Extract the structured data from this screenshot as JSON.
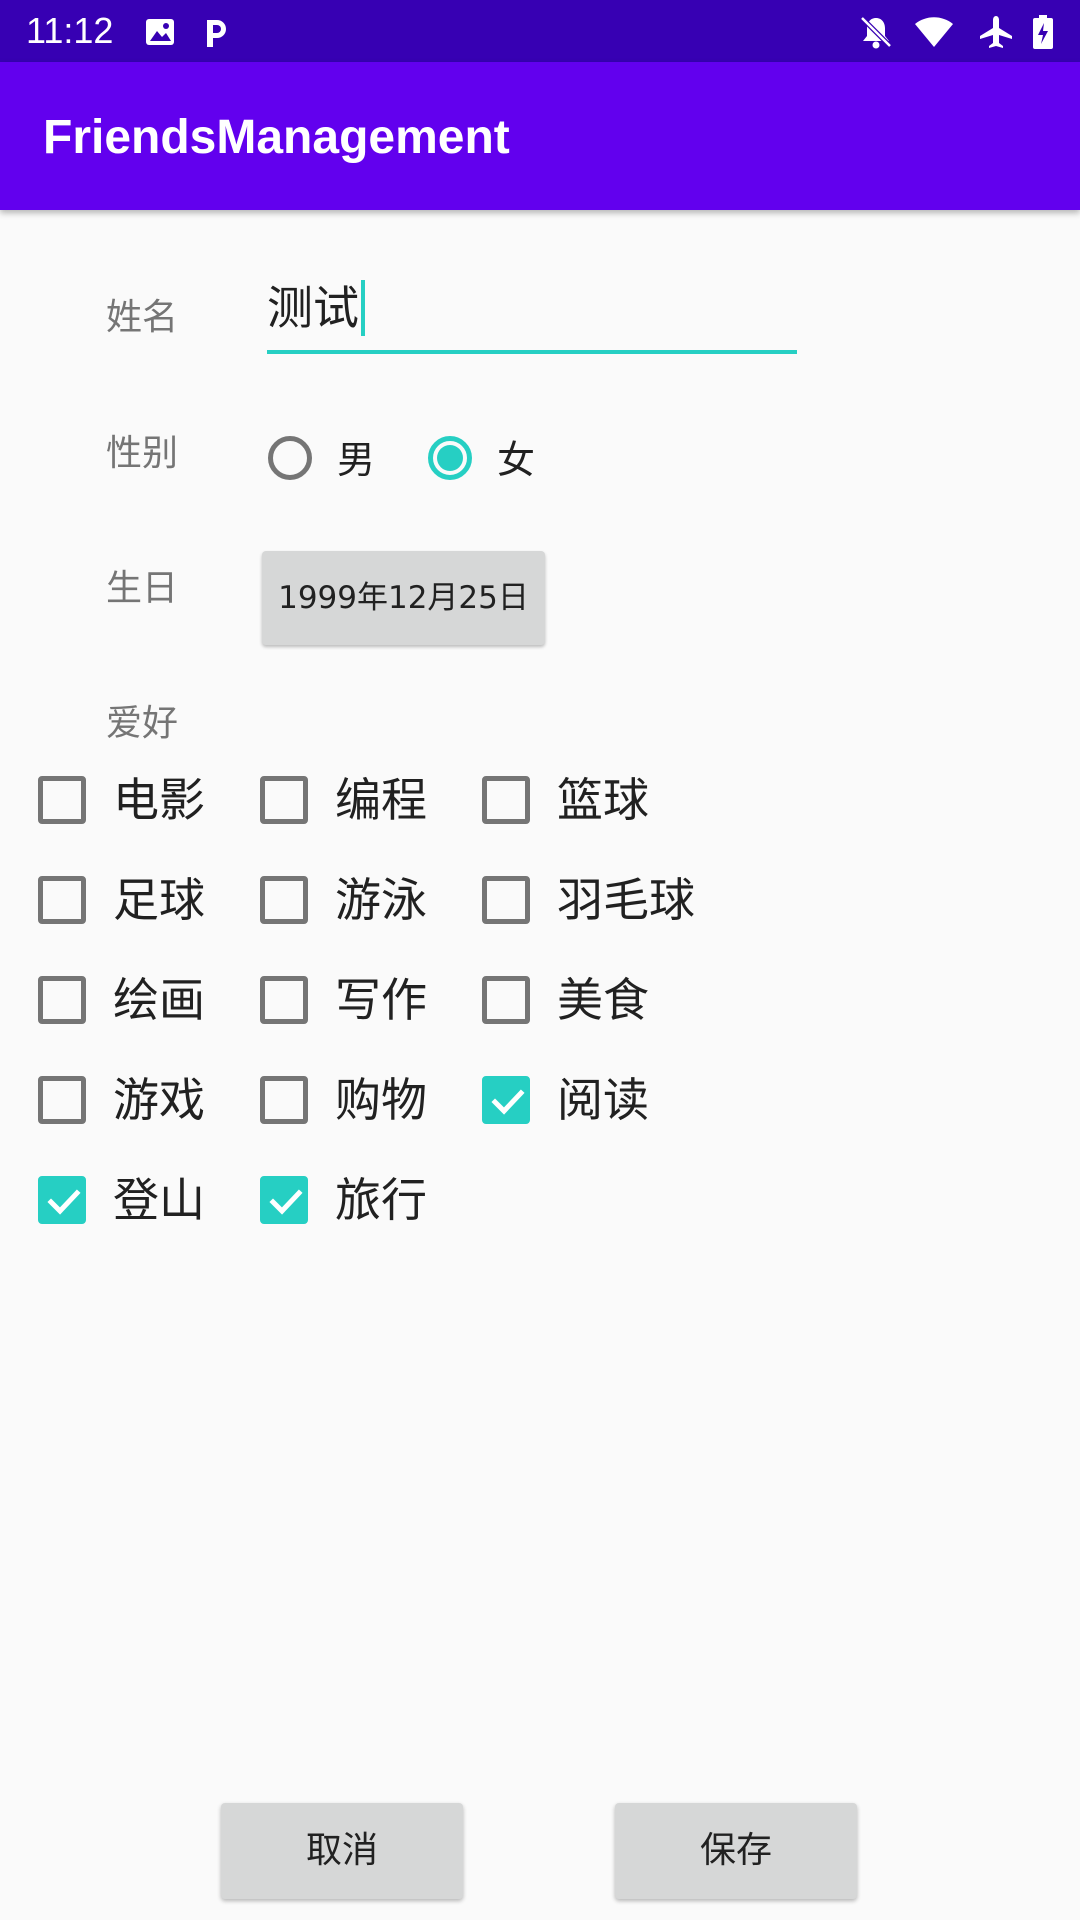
{
  "status_bar": {
    "time": "11:12",
    "icons": [
      "image-icon",
      "parking-icon",
      "notifications-off-icon",
      "wifi-icon",
      "airplane-icon",
      "battery-charging-icon"
    ]
  },
  "app_bar": {
    "title": "FriendsManagement",
    "color": "#6200ee"
  },
  "form": {
    "name": {
      "label": "姓名",
      "value": "测试"
    },
    "gender": {
      "label": "性别",
      "options": [
        {
          "label": "男",
          "checked": false
        },
        {
          "label": "女",
          "checked": true
        }
      ]
    },
    "birthday": {
      "label": "生日",
      "value": "1999年12月25日"
    },
    "hobbies": {
      "label": "爱好",
      "items": [
        {
          "label": "电影",
          "checked": false
        },
        {
          "label": "编程",
          "checked": false
        },
        {
          "label": "篮球",
          "checked": false
        },
        {
          "label": "足球",
          "checked": false
        },
        {
          "label": "游泳",
          "checked": false
        },
        {
          "label": "羽毛球",
          "checked": false
        },
        {
          "label": "绘画",
          "checked": false
        },
        {
          "label": "写作",
          "checked": false
        },
        {
          "label": "美食",
          "checked": false
        },
        {
          "label": "游戏",
          "checked": false
        },
        {
          "label": "购物",
          "checked": false
        },
        {
          "label": "阅读",
          "checked": true
        },
        {
          "label": "登山",
          "checked": true
        },
        {
          "label": "旅行",
          "checked": true
        }
      ]
    }
  },
  "actions": {
    "cancel_label": "取消",
    "save_label": "保存"
  },
  "colors": {
    "status_bar": "#3700b3",
    "primary": "#6200ee",
    "accent": "#26cfc3"
  }
}
